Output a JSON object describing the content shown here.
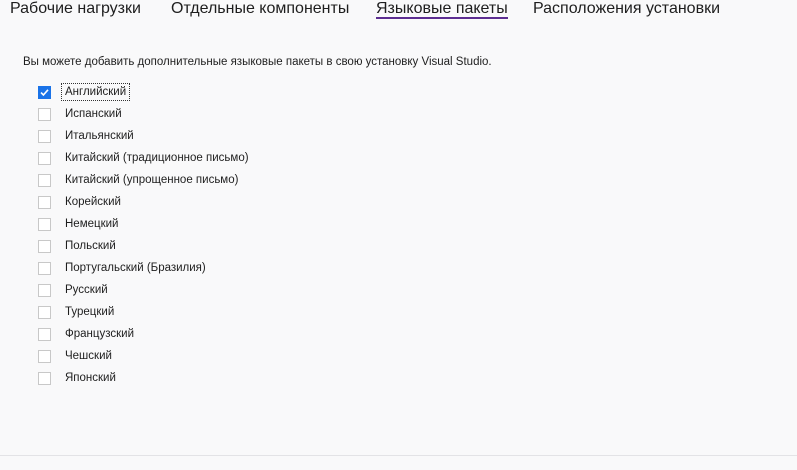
{
  "tabs": [
    {
      "label": "Рабочие нагрузки"
    },
    {
      "label": "Отдельные компоненты"
    },
    {
      "label": "Языковые пакеты"
    },
    {
      "label": "Расположения установки"
    }
  ],
  "active_tab": "Языковые пакеты",
  "description": "Вы можете добавить дополнительные языковые пакеты в свою установку Visual Studio.",
  "languages": [
    {
      "label": "Английский",
      "checked": true
    },
    {
      "label": "Испанский",
      "checked": false
    },
    {
      "label": "Итальянский",
      "checked": false
    },
    {
      "label": "Китайский (традиционное письмо)",
      "checked": false
    },
    {
      "label": "Китайский (упрощенное письмо)",
      "checked": false
    },
    {
      "label": "Корейский",
      "checked": false
    },
    {
      "label": "Немецкий",
      "checked": false
    },
    {
      "label": "Польский",
      "checked": false
    },
    {
      "label": "Португальский (Бразилия)",
      "checked": false
    },
    {
      "label": "Русский",
      "checked": false
    },
    {
      "label": "Турецкий",
      "checked": false
    },
    {
      "label": "Французский",
      "checked": false
    },
    {
      "label": "Чешский",
      "checked": false
    },
    {
      "label": "Японский",
      "checked": false
    }
  ],
  "colors": {
    "accent": "#5c2d91",
    "checkbox_checked": "#1a73e8",
    "background": "#f9f9fa"
  }
}
